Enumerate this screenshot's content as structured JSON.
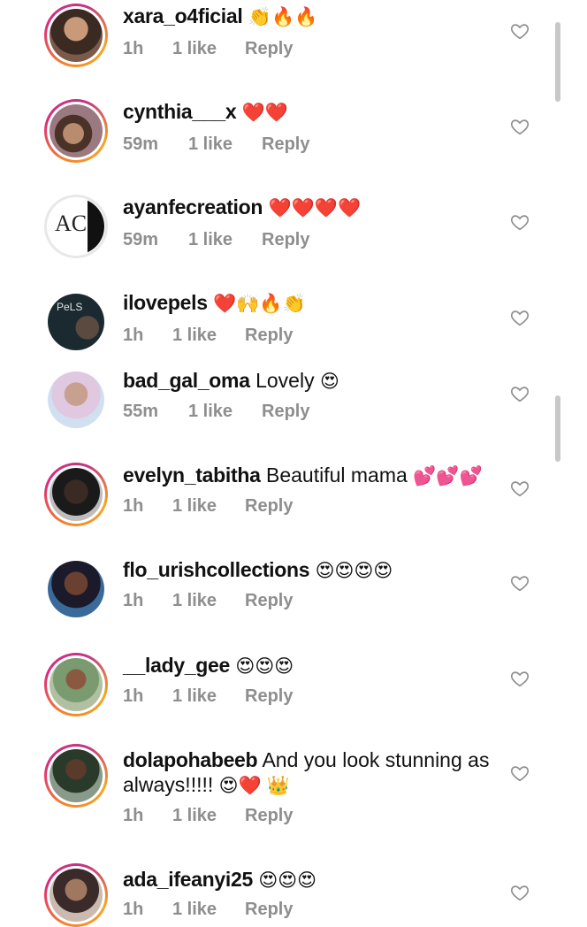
{
  "comments": [
    {
      "username": "xara_o4ficial",
      "text": "",
      "emoji": "👏🔥🔥",
      "time": "1h",
      "likes": "1 like",
      "reply": "Reply"
    },
    {
      "username": "cynthia___x",
      "text": "",
      "emoji": "❤️❤️",
      "time": "59m",
      "likes": "1 like",
      "reply": "Reply"
    },
    {
      "username": "ayanfecreation",
      "text": "",
      "emoji": "❤️❤️❤️❤️",
      "time": "59m",
      "likes": "1 like",
      "reply": "Reply"
    },
    {
      "username": "ilovepels",
      "text": "",
      "emoji": "❤️🙌🔥👏",
      "time": "1h",
      "likes": "1 like",
      "reply": "Reply"
    },
    {
      "username": "bad_gal_oma",
      "text": "Lovely",
      "emoji": "😍",
      "time": "55m",
      "likes": "1 like",
      "reply": "Reply"
    },
    {
      "username": "evelyn_tabitha",
      "text": "Beautiful mama",
      "emoji": "💕💕💕",
      "time": "1h",
      "likes": "1 like",
      "reply": "Reply"
    },
    {
      "username": "flo_urishcollections",
      "text": "",
      "emoji": "😍😍😍😍",
      "time": "1h",
      "likes": "1 like",
      "reply": "Reply"
    },
    {
      "username": "__lady_gee",
      "text": "",
      "emoji": "😍😍😍",
      "time": "1h",
      "likes": "1 like",
      "reply": "Reply"
    },
    {
      "username": "dolapohabeeb",
      "text": "And you look stunning as",
      "text2": "always!!!!!",
      "emoji": "😍❤️ 👑",
      "time": "1h",
      "likes": "1 like",
      "reply": "Reply"
    },
    {
      "username": "ada_ifeanyi25",
      "text": "",
      "emoji": "😍😍😍",
      "time": "1h",
      "likes": "1 like",
      "reply": "Reply"
    }
  ],
  "avatars": {
    "ayanfecreation_logo": "AC",
    "ilovepels_logo": "PeLS"
  },
  "icons": {
    "like": "heart-outline-icon"
  },
  "colors": {
    "story_ring_start": "#f58529",
    "story_ring_mid": "#dd2a7b",
    "meta_text": "#8e8e8e",
    "username": "#111111"
  }
}
